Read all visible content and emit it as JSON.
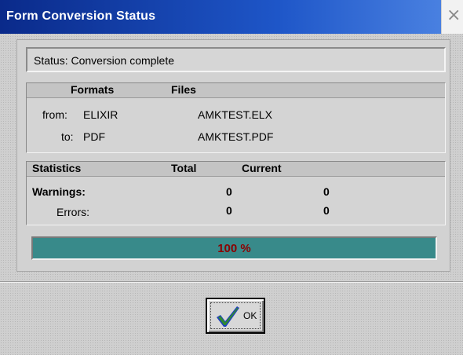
{
  "window": {
    "title": "Form Conversion Status",
    "close_glyph": "×"
  },
  "status": {
    "label": "Status:",
    "value": "Conversion complete"
  },
  "formats": {
    "header_formats": "Formats",
    "header_files": "Files",
    "rows": [
      {
        "label": "from:",
        "format": "ELIXIR",
        "file": "AMKTEST.ELX"
      },
      {
        "label": "to:",
        "format": "PDF",
        "file": "AMKTEST.PDF"
      }
    ]
  },
  "statistics": {
    "header_statistics": "Statistics",
    "header_total": "Total",
    "header_current": "Current",
    "rows": [
      {
        "label": "Warnings:",
        "total": "0",
        "current": "0"
      },
      {
        "label": "Errors:",
        "total": "0",
        "current": "0"
      }
    ]
  },
  "progress": {
    "percent": 100,
    "label": "100 %"
  },
  "ok_button": {
    "label": "OK",
    "icon": "checkmark-icon"
  },
  "colors": {
    "titlebar_start": "#0a2a8a",
    "titlebar_end": "#4f86e4",
    "progress_fill": "#3d9292",
    "progress_text": "#8b0000",
    "check_blue": "#1f3fbf",
    "check_green": "#2e8b2e"
  }
}
